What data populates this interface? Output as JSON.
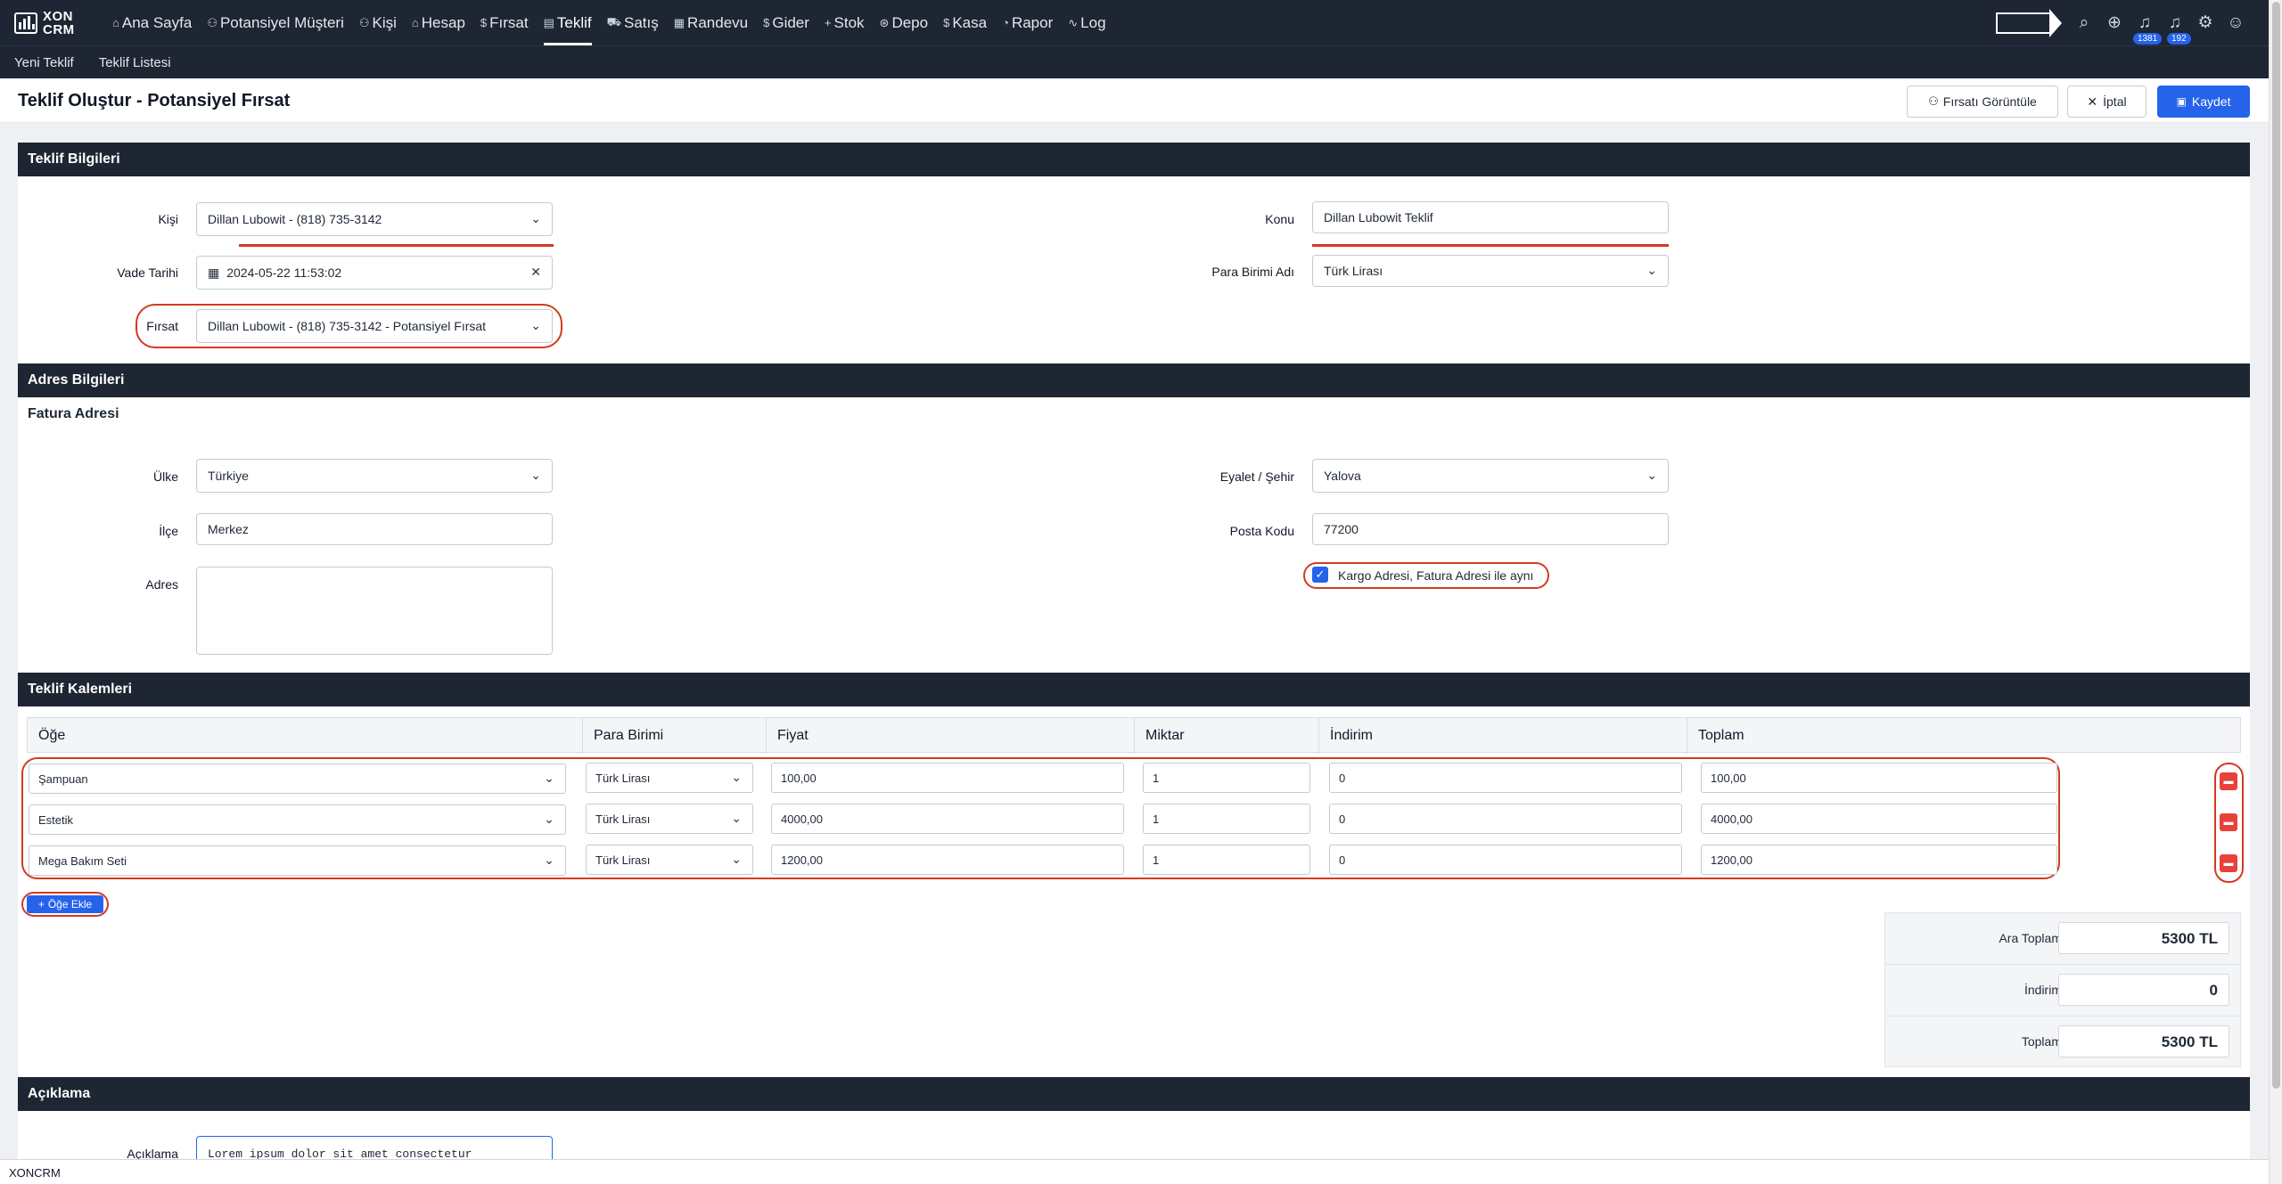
{
  "app": {
    "logo_line1": "XON",
    "logo_line2": "CRM",
    "footer": "XONCRM"
  },
  "nav": [
    {
      "label": "Ana Sayfa",
      "icon": "⌂"
    },
    {
      "label": "Potansiyel Müşteri",
      "icon": "⚇"
    },
    {
      "label": "Kişi",
      "icon": "⚇"
    },
    {
      "label": "Hesap",
      "icon": "⌂"
    },
    {
      "label": "Fırsat",
      "icon": "$"
    },
    {
      "label": "Teklif",
      "icon": "▤"
    },
    {
      "label": "Satış",
      "icon": "⛟"
    },
    {
      "label": "Randevu",
      "icon": "▦"
    },
    {
      "label": "Gider",
      "icon": "$"
    },
    {
      "label": "Stok",
      "icon": "+"
    },
    {
      "label": "Depo",
      "icon": "⊛"
    },
    {
      "label": "Kasa",
      "icon": "$"
    },
    {
      "label": "Rapor",
      "icon": "◔"
    },
    {
      "label": "Log",
      "icon": "∿"
    }
  ],
  "notifications": {
    "badge1": "1381",
    "badge2": "192"
  },
  "subnav": [
    "Yeni Teklif",
    "Teklif Listesi"
  ],
  "page": {
    "title": "Teklif Oluştur - Potansiyel Fırsat",
    "btn_view": "Fırsatı Görüntüle",
    "btn_cancel": "İptal",
    "btn_save": "Kaydet"
  },
  "teklif": {
    "heading": "Teklif Bilgileri",
    "kisi_label": "Kişi",
    "kisi_value": "Dillan Lubowit - (818) 735-3142",
    "vade_label": "Vade Tarihi",
    "vade_value": "2024-05-22 11:53:02",
    "firsat_label": "Fırsat",
    "firsat_value": "Dillan Lubowit - (818) 735-3142 - Potansiyel Fırsat",
    "konu_label": "Konu",
    "konu_value": "Dillan Lubowit Teklif",
    "para_label": "Para Birimi Adı",
    "para_value": "Türk Lirası"
  },
  "adres": {
    "heading": "Adres Bilgileri",
    "subheading": "Fatura Adresi",
    "ulke_label": "Ülke",
    "ulke_value": "Türkiye",
    "ilce_label": "İlçe",
    "ilce_value": "Merkez",
    "adres_label": "Adres",
    "adres_value": "",
    "sehir_label": "Eyalet / Şehir",
    "sehir_value": "Yalova",
    "posta_label": "Posta Kodu",
    "posta_value": "77200",
    "kargo_label": "Kargo Adresi, Fatura Adresi ile aynı",
    "kargo_checked": true
  },
  "kalemler": {
    "heading": "Teklif Kalemleri",
    "columns": [
      "Öğe",
      "Para Birimi",
      "Fiyat",
      "Miktar",
      "İndirim",
      "Toplam"
    ],
    "rows": [
      {
        "item": "Şampuan",
        "currency": "Türk Lirası",
        "price": "100,00",
        "qty": "1",
        "discount": "0",
        "total": "100,00"
      },
      {
        "item": "Estetik",
        "currency": "Türk Lirası",
        "price": "4000,00",
        "qty": "1",
        "discount": "0",
        "total": "4000,00"
      },
      {
        "item": "Mega Bakım Seti",
        "currency": "Türk Lirası",
        "price": "1200,00",
        "qty": "1",
        "discount": "0",
        "total": "1200,00"
      }
    ],
    "add_label": "Öğe Ekle"
  },
  "summary": {
    "ara_label": "Ara Toplam",
    "ara_value": "5300 TL",
    "indirim_label": "İndirim",
    "indirim_value": "0",
    "toplam_label": "Toplam",
    "toplam_value": "5300 TL"
  },
  "aciklama": {
    "heading": "Açıklama",
    "label": "Açıklama",
    "value": "Lorem ipsum dolor sit amet consectetur"
  },
  "colors": {
    "nav_bg": "#1e2533",
    "primary": "#2563eb",
    "highlight": "#d23a22",
    "danger": "#e8413a"
  }
}
